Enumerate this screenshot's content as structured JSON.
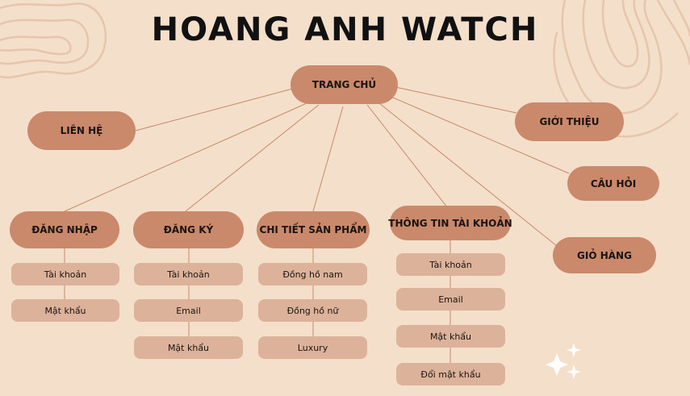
{
  "title": "HOANG ANH WATCH",
  "root": "TRANG CHỦ",
  "top_nodes": {
    "lien_he": "LIÊN HỆ",
    "gioi_thieu": "GIỚI THIỆU",
    "cau_hoi": "CÂU HỎI",
    "gio_hang": "GIỎ HÀNG"
  },
  "sections": {
    "dang_nhap": {
      "label": "ĐĂNG NHẬP",
      "items": [
        "Tài khoản",
        "Mật khẩu"
      ]
    },
    "dang_ky": {
      "label": "ĐĂNG KÝ",
      "items": [
        "Tài khoản",
        "Email",
        "Mật khẩu"
      ]
    },
    "chi_tiet": {
      "label": "CHI TIẾT SẢN PHẨM",
      "items": [
        "Đồng hồ nam",
        "Đồng hồ nữ",
        "Luxury"
      ]
    },
    "thong_tin": {
      "label": "THÔNG TIN TÀI KHOẢN",
      "items": [
        "Tài khoản",
        "Email",
        "Mật khẩu",
        "Đổi mật khẩu"
      ]
    }
  },
  "colors": {
    "background": "#f4dfcb",
    "main_node": "#c9896a",
    "sub_node": "#dcb29b",
    "connector": "#c9896a",
    "decor": "#e6c5ac"
  }
}
